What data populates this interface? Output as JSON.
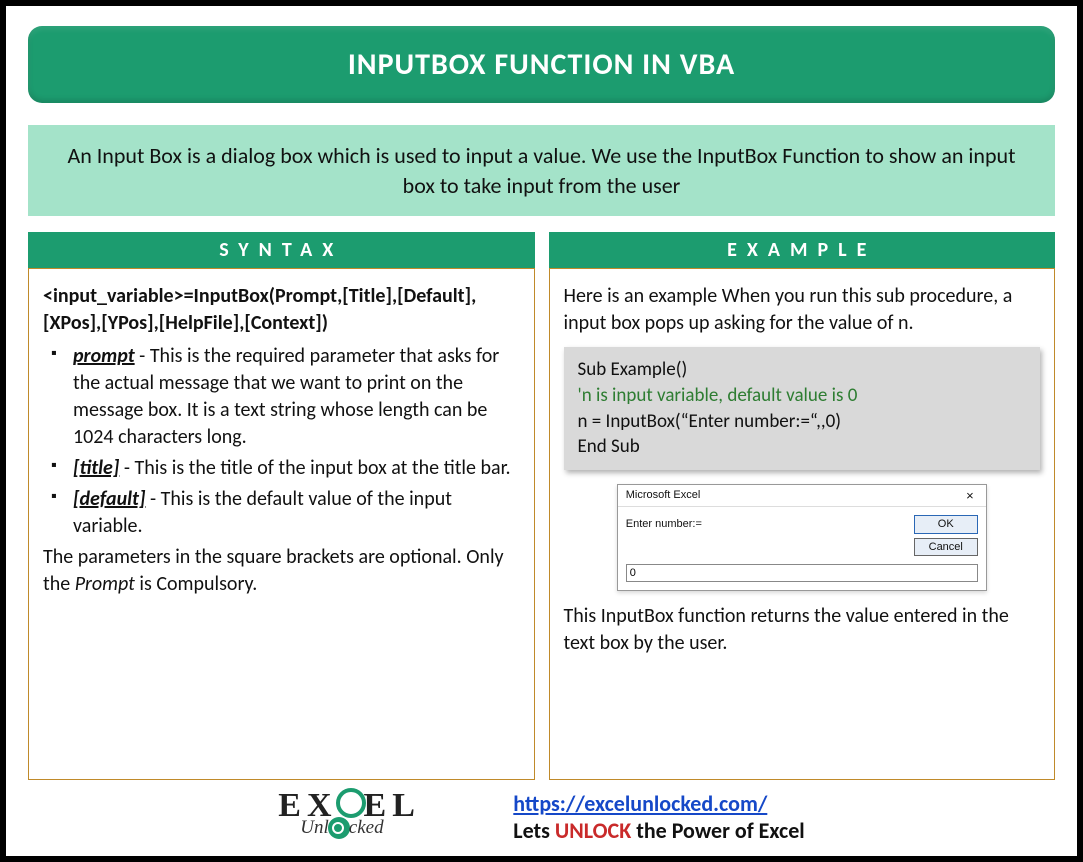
{
  "title": "INPUTBOX FUNCTION IN VBA",
  "intro": "An Input Box is a dialog box which is used to input a value. We use the InputBox Function to show an input box to take input from the user",
  "syntax": {
    "header": "SYNTAX",
    "signature": "<input_variable>=InputBox(Prompt,[Title],[Default],[XPos],[YPos],[HelpFile],[Context])",
    "params": [
      {
        "name": "prompt",
        "sep": " - ",
        "desc": "This is the required parameter that asks for the actual message that we want to print on the message box. It is a text string whose length can be 1024 characters long."
      },
      {
        "name": "[title]",
        "sep": " - ",
        "desc": "This is the title of the input box at the title bar."
      },
      {
        "name": "[default]",
        "sep": " - ",
        "desc": "This is the default value of the input variable."
      }
    ],
    "optional_note_pre": "The parameters in the square brackets are optional. Only the ",
    "optional_note_em": "Prompt",
    "optional_note_post": " is Compulsory."
  },
  "example": {
    "header": "EXAMPLE",
    "intro": "Here is an example When you run this sub procedure, a input box pops up asking for the value of n.",
    "code": {
      "l1": "Sub Example()",
      "l2": "'n is input variable, default value is 0",
      "l3": "n = InputBox(“Enter number:=“,,0)",
      "l4": "End Sub"
    },
    "dialog": {
      "title": "Microsoft Excel",
      "close": "×",
      "prompt": "Enter number:=",
      "ok": "OK",
      "cancel": "Cancel",
      "value": "0"
    },
    "outro": "This InputBox function returns the value entered in the text box by the user."
  },
  "footer": {
    "logo_top_pre": "EX",
    "logo_top_post": "EL",
    "logo_bottom_pre": "Unl",
    "logo_bottom_post": "cked",
    "url": "https://excelunlocked.com/",
    "tagline_pre": "Lets ",
    "tagline_word": "UNLOCK",
    "tagline_post": " the Power of Excel"
  }
}
